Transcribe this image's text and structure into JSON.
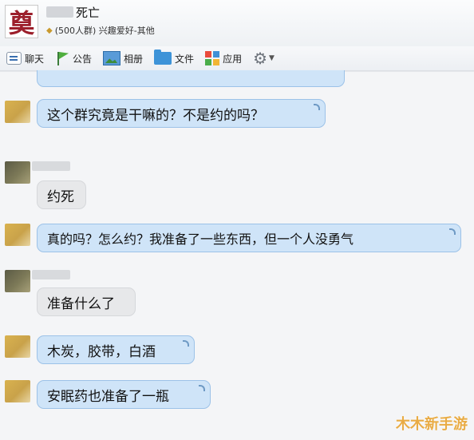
{
  "header": {
    "group_avatar_char": "奠",
    "group_title": "死亡",
    "subtitle": "(500人群) 兴趣爱好-其他"
  },
  "toolbar": {
    "items": [
      {
        "label": "聊天",
        "icon": "chat-icon"
      },
      {
        "label": "公告",
        "icon": "flag-icon"
      },
      {
        "label": "相册",
        "icon": "photo-icon"
      },
      {
        "label": "文件",
        "icon": "folder-icon"
      },
      {
        "label": "应用",
        "icon": "apps-icon"
      }
    ],
    "settings_icon": "gear-icon"
  },
  "messages": [
    {
      "text": "这个群究竟是干嘛的？不是约的吗？",
      "style": "blue"
    },
    {
      "text": "约死",
      "style": "gray"
    },
    {
      "text": "真的吗？怎么约？我准备了一些东西，但一个人没勇气",
      "style": "blue"
    },
    {
      "text": "准备什么了",
      "style": "gray"
    },
    {
      "text": "木炭，胶带，白酒",
      "style": "blue"
    },
    {
      "text": "安眠药也准备了一瓶",
      "style": "blue"
    }
  ],
  "watermark": "木木新手游",
  "colors": {
    "bubble_blue": "#cfe4f8",
    "bubble_gray": "#e7e8ea",
    "watermark": "#e9ac45"
  }
}
